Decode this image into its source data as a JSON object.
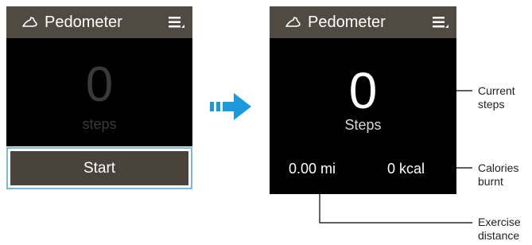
{
  "left_screen": {
    "title": "Pedometer",
    "steps_value": "0",
    "steps_label": "steps",
    "start_label": "Start"
  },
  "right_screen": {
    "title": "Pedometer",
    "steps_value": "0",
    "steps_label": "Steps",
    "distance": "0.00 mi",
    "calories": "0 kcal"
  },
  "callouts": {
    "current_steps": [
      "Current",
      "steps"
    ],
    "calories_burnt": [
      "Calories",
      "burnt"
    ],
    "exercise_distance": [
      "Exercise",
      "distance"
    ]
  },
  "colors": {
    "titlebar": "#504a43",
    "start_button": "#4a433c",
    "focus_border": "#7db7d6",
    "arrow": "#1a9ad9"
  },
  "icons": {
    "title_icon": "shoe-icon",
    "menu": "menu-icon",
    "transition": "arrow-right-icon"
  }
}
